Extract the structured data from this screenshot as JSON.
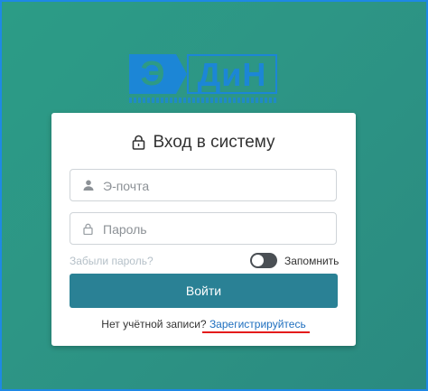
{
  "brand": {
    "logo_text": "ЭДиН",
    "accent": "#1c86d6"
  },
  "login": {
    "title": "Вход в систему",
    "email_placeholder": "Э-почта",
    "password_placeholder": "Пароль",
    "forgot": "Забыли пароль?",
    "remember": "Запомнить",
    "remember_on": false,
    "submit": "Войти",
    "no_account": "Нет учётной записи?",
    "register": "Зарегистрируйтесь"
  },
  "colors": {
    "background": "#2d9585",
    "button": "#2a8195",
    "link": "#1e6fbf",
    "highlight": "#e41b1b"
  }
}
